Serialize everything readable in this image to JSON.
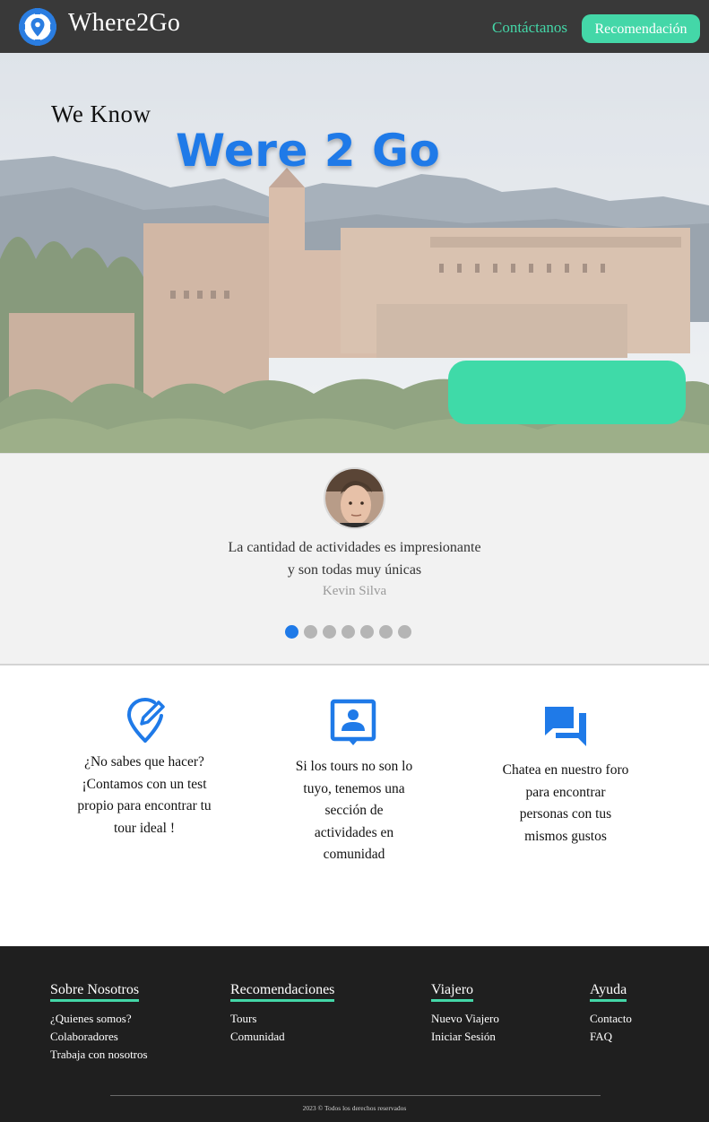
{
  "colors": {
    "accent": "#44d7a8",
    "brand_blue": "#1f7ae8",
    "navbar_bg": "#393939",
    "footer_bg": "#1f1f1f"
  },
  "navbar": {
    "brand": "Where2Go",
    "logo_icon": "location-pin-gear-icon",
    "links": {
      "contact": "Contáctanos",
      "recommendation": "Recomendación"
    }
  },
  "hero": {
    "tagline_small": "We Know",
    "tagline_big": "Were 2 Go",
    "cta_label": ""
  },
  "testimonial": {
    "quote_line1": "La cantidad de actividades es impresionante",
    "quote_line2": "y son todas muy únicas",
    "author": "Kevin Silva",
    "slide_count": 7,
    "active_slide": 1
  },
  "features": [
    {
      "icon": "edit-location-icon",
      "lines": [
        "¿No sabes que hacer?",
        "¡Contamos con un test",
        "propio para encontrar tu",
        "tour ideal !"
      ]
    },
    {
      "icon": "contact-card-icon",
      "lines": [
        "Si los tours no son lo",
        "tuyo, tenemos una",
        "sección de",
        "actividades en",
        "comunidad"
      ]
    },
    {
      "icon": "forum-chat-icon",
      "lines": [
        "Chatea en nuestro foro",
        "para encontrar",
        "personas con tus",
        "mismos gustos"
      ]
    }
  ],
  "footer": {
    "columns": [
      {
        "title": "Sobre Nosotros",
        "links": [
          "¿Quienes somos?",
          "Colaboradores",
          "Trabaja con nosotros"
        ]
      },
      {
        "title": "Recomendaciones",
        "links": [
          "Tours",
          "Comunidad"
        ]
      },
      {
        "title": "Viajero",
        "links": [
          "Nuevo Viajero",
          "Iniciar Sesión"
        ]
      },
      {
        "title": "Ayuda",
        "links": [
          "Contacto",
          "FAQ"
        ]
      }
    ],
    "copyright": "2023 © Todos los derechos reservados"
  }
}
